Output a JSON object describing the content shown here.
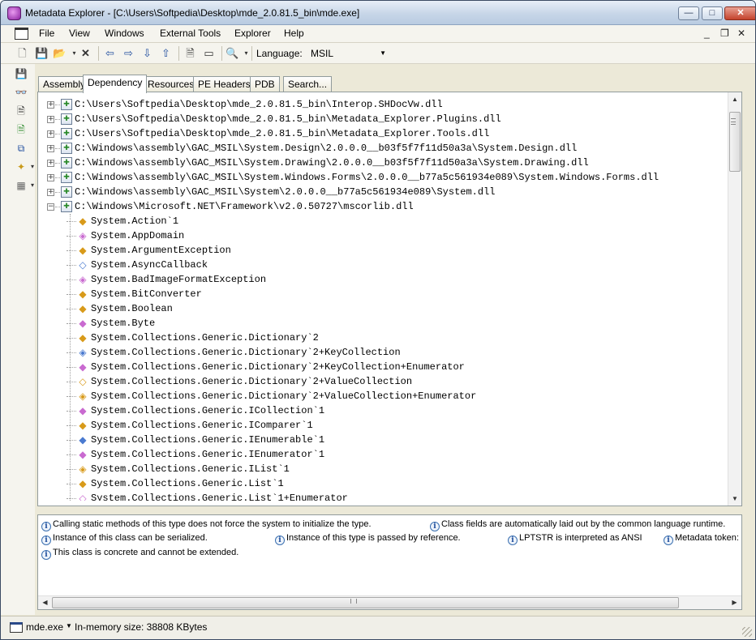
{
  "window": {
    "title": "Metadata Explorer - [C:\\Users\\Softpedia\\Desktop\\mde_2.0.81.5_bin\\mde.exe]",
    "minimize": "—",
    "maximize": "□",
    "close": "✕"
  },
  "menu": {
    "items": [
      "File",
      "View",
      "Windows",
      "External Tools",
      "Explorer",
      "Help"
    ],
    "mdi_min": "_",
    "mdi_restore": "❐",
    "mdi_close": "✕"
  },
  "toolbar": {
    "language_label": "Language:",
    "language_value": "MSIL"
  },
  "tabs": [
    "Assembly",
    "Dependency",
    "Resources",
    "PE Headers",
    "PDB",
    "Search..."
  ],
  "active_tab": "Dependency",
  "tree": {
    "assemblies": [
      {
        "expander": "+",
        "path": "C:\\Users\\Softpedia\\Desktop\\mde_2.0.81.5_bin\\Interop.SHDocVw.dll"
      },
      {
        "expander": "+",
        "path": "C:\\Users\\Softpedia\\Desktop\\mde_2.0.81.5_bin\\Metadata_Explorer.Plugins.dll"
      },
      {
        "expander": "+",
        "path": "C:\\Users\\Softpedia\\Desktop\\mde_2.0.81.5_bin\\Metadata_Explorer.Tools.dll"
      },
      {
        "expander": "+",
        "path": "C:\\Windows\\assembly\\GAC_MSIL\\System.Design\\2.0.0.0__b03f5f7f11d50a3a\\System.Design.dll"
      },
      {
        "expander": "+",
        "path": "C:\\Windows\\assembly\\GAC_MSIL\\System.Drawing\\2.0.0.0__b03f5f7f11d50a3a\\System.Drawing.dll"
      },
      {
        "expander": "+",
        "path": "C:\\Windows\\assembly\\GAC_MSIL\\System.Windows.Forms\\2.0.0.0__b77a5c561934e089\\System.Windows.Forms.dll"
      },
      {
        "expander": "+",
        "path": "C:\\Windows\\assembly\\GAC_MSIL\\System\\2.0.0.0__b77a5c561934e089\\System.dll"
      },
      {
        "expander": "−",
        "path": "C:\\Windows\\Microsoft.NET\\Framework\\v2.0.50727\\mscorlib.dll"
      }
    ],
    "types": [
      "System.Action`1",
      "System.AppDomain",
      "System.ArgumentException",
      "System.AsyncCallback",
      "System.BadImageFormatException",
      "System.BitConverter",
      "System.Boolean",
      "System.Byte",
      "System.Collections.Generic.Dictionary`2",
      "System.Collections.Generic.Dictionary`2+KeyCollection",
      "System.Collections.Generic.Dictionary`2+KeyCollection+Enumerator",
      "System.Collections.Generic.Dictionary`2+ValueCollection",
      "System.Collections.Generic.Dictionary`2+ValueCollection+Enumerator",
      "System.Collections.Generic.ICollection`1",
      "System.Collections.Generic.IComparer`1",
      "System.Collections.Generic.IEnumerable`1",
      "System.Collections.Generic.IEnumerator`1",
      "System.Collections.Generic.IList`1",
      "System.Collections.Generic.List`1",
      "System.Collections.Generic.List`1+Enumerator"
    ]
  },
  "info": {
    "messages": [
      "Calling static methods of this type does not force the system to initialize the type.",
      "Class fields are automatically laid out by the common language runtime.",
      "Instance of this class can be serialized.",
      "Instance of this type is passed by reference.",
      "LPTSTR is interpreted as ANSI",
      "Metadata token:",
      "This class is concrete and cannot be extended."
    ]
  },
  "status": {
    "file": "mde.exe",
    "memory": "In-memory size: 38808 KBytes"
  },
  "icons": {
    "new": "new-file-icon",
    "save": "save-icon",
    "open": "open-folder-icon",
    "delete": "delete-icon",
    "back": "back-arrow-icon",
    "forward": "forward-arrow-icon",
    "assembly": "assembly-icon",
    "info": "info-icon"
  }
}
